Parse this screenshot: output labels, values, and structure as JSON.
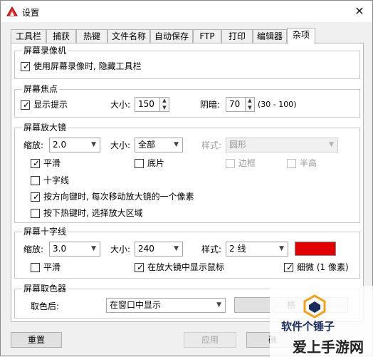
{
  "window": {
    "title": "设置",
    "close_glyph": "✕"
  },
  "tabs": [
    "工具栏",
    "捕获",
    "热键",
    "文件名称",
    "自动保存",
    "FTP",
    "打印",
    "编辑器",
    "杂项"
  ],
  "recorder": {
    "title": "屏幕录像机",
    "hide_toolbar": {
      "label": "使用屏幕录像时, 隐藏工具栏",
      "checked": true
    }
  },
  "focus": {
    "title": "屏幕焦点",
    "show_hint": {
      "label": "显示提示",
      "checked": true
    },
    "size_label": "大小:",
    "size_value": "150",
    "shadow_label": "阴暗:",
    "shadow_value": "70",
    "range_text": "(30 - 100)"
  },
  "magnifier": {
    "title": "屏幕放大镜",
    "zoom_label": "缩放:",
    "zoom_value": "2.0",
    "size_label": "大小:",
    "size_value": "全部",
    "style_label": "样式:",
    "style_value": "圆形",
    "smooth": {
      "label": "平滑",
      "checked": true
    },
    "negative": {
      "label": "底片",
      "checked": false
    },
    "border": {
      "label": "边框",
      "checked": false
    },
    "translucent": {
      "label": "半高",
      "checked": false
    },
    "crosshair": {
      "label": "十字线",
      "checked": false
    },
    "arrow_move": {
      "label": "按方向键时, 每次移动放大镜的一个像素",
      "checked": true
    },
    "hotkey_select": {
      "label": "按下热键时, 选择放大区域",
      "checked": false
    }
  },
  "crosshair": {
    "title": "屏幕十字线",
    "zoom_label": "缩放:",
    "zoom_value": "3.0",
    "size_label": "大小:",
    "size_value": "240",
    "style_label": "样式:",
    "style_value": "2 线",
    "color": "#e00000",
    "smooth": {
      "label": "平滑",
      "checked": false
    },
    "show_cursor": {
      "label": "在放大镜中显示鼠标",
      "checked": true
    },
    "thin": {
      "label": "细微 (1 像素)",
      "checked": true
    }
  },
  "picker": {
    "title": "屏幕取色器",
    "after_label": "取色后:",
    "after_value": "在窗口中显示",
    "button_label": "格"
  },
  "footer": {
    "reset": "重置",
    "apply": "应用",
    "ok": "确"
  },
  "watermark": {
    "line1": "软件个锤子",
    "line2": "爱上手游网"
  }
}
